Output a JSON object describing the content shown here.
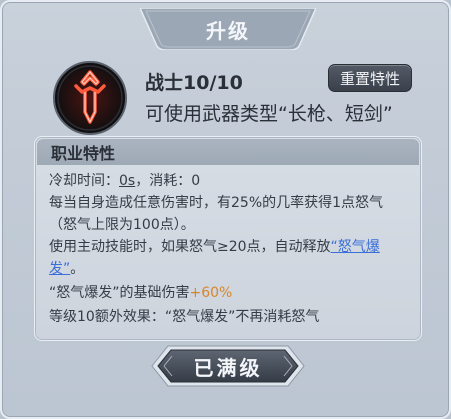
{
  "header": {
    "title": "升级"
  },
  "class_info": {
    "class_level": "战士10/10",
    "weapon_types": "可使用武器类型“长枪、短剑”",
    "icon": "sword-emblem-icon"
  },
  "reset_button": {
    "label": "重置特性"
  },
  "traits": {
    "header": "职业特性",
    "cooldown_label": "冷却时间：",
    "cooldown_value": "0s",
    "cost_text": "，消耗：0",
    "line2": "每当自身造成任意伤害时，有25%的几率获得1点怒气",
    "line3": "（怒气上限为100点）。",
    "line4_prefix": "使用主动技能时，如果怒气≥20点，自动释放",
    "skill_link_part1": "“怒气爆",
    "skill_link_part2": "发”",
    "line5_suffix": "。",
    "line6_prefix": "“怒气爆发”的基础伤害",
    "line6_bonus": "+60%",
    "line7": "等级10额外效果：“怒气爆发”不再消耗怒气"
  },
  "footer": {
    "maxed_label": "已满级"
  },
  "colors": {
    "panel_bg": "#c2cbd6",
    "header_tab": "#9aa6b4",
    "button_dark": "#3a414b",
    "link": "#3a6fd8",
    "bonus": "#d8862a",
    "icon_glow": "#e0392b"
  }
}
